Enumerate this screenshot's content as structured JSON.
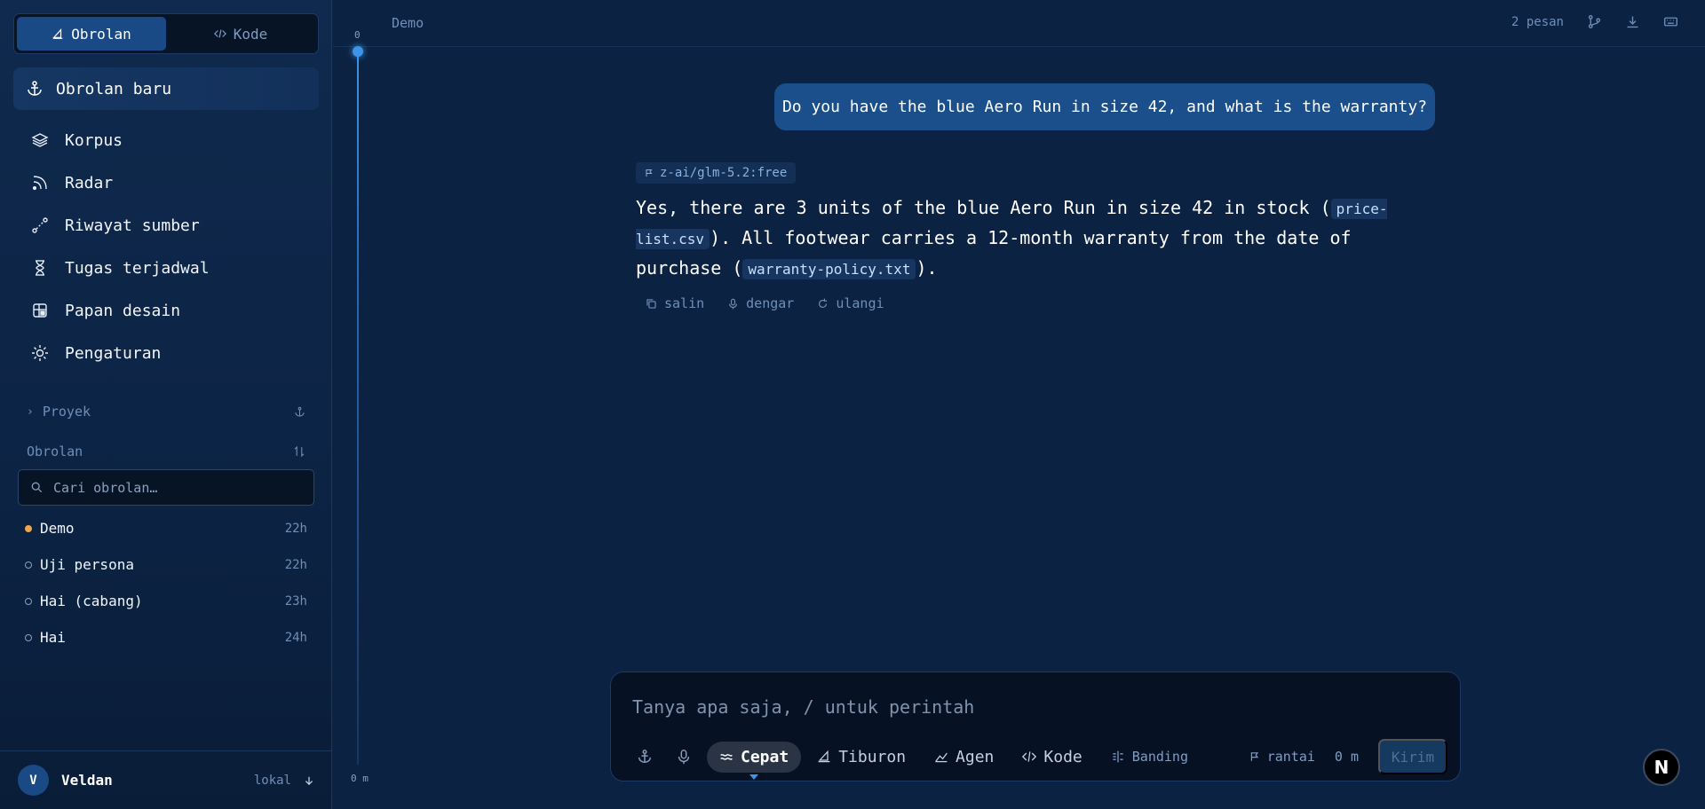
{
  "sidebar": {
    "mode_tabs": [
      {
        "label": "Obrolan",
        "icon": "sail-icon",
        "active": true
      },
      {
        "label": "Kode",
        "icon": "code-icon",
        "active": false
      }
    ],
    "new_chat_label": "Obrolan baru",
    "nav": [
      {
        "label": "Korpus",
        "icon": "layers-icon"
      },
      {
        "label": "Radar",
        "icon": "rss-icon"
      },
      {
        "label": "Riwayat sumber",
        "icon": "route-icon"
      },
      {
        "label": "Tugas terjadwal",
        "icon": "hourglass-icon"
      },
      {
        "label": "Papan desain",
        "icon": "layout-icon"
      },
      {
        "label": "Pengaturan",
        "icon": "sun-gear-icon"
      }
    ],
    "projects_label": "Proyek",
    "chats_section_label": "Obrolan",
    "search_placeholder": "Cari obrolan…",
    "chats": [
      {
        "title": "Demo",
        "time": "22h",
        "active": true
      },
      {
        "title": "Uji persona",
        "time": "22h",
        "active": false
      },
      {
        "title": "Hai (cabang)",
        "time": "23h",
        "active": false
      },
      {
        "title": "Hai",
        "time": "24h",
        "active": false
      }
    ],
    "user": {
      "initial": "V",
      "name": "Veldan",
      "location": "lokal"
    }
  },
  "topbar": {
    "title": "Demo",
    "message_count": "2 pesan"
  },
  "timeline": {
    "top_label": "0",
    "bottom_label": "0 m"
  },
  "conversation": {
    "user_message": "Do you have the blue Aero Run in size 42, and what is the warranty?",
    "model": "z-ai/glm-5.2:free",
    "assistant": {
      "part1": "Yes, there are 3 units of the blue Aero Run in size 42 in stock (",
      "source1": "price-list.csv",
      "part2": "). All footwear carries a 12-month warranty from the date of purchase (",
      "source2": "warranty-policy.txt",
      "part3": ")."
    },
    "actions": {
      "copy": "salin",
      "listen": "dengar",
      "retry": "ulangi"
    }
  },
  "composer": {
    "placeholder": "Tanya apa saja, / untuk perintah",
    "modes": [
      {
        "label": "Cepat",
        "icon": "waves-icon",
        "active": true
      },
      {
        "label": "Tiburon",
        "icon": "sail-icon",
        "active": false
      },
      {
        "label": "Agen",
        "icon": "agent-icon",
        "active": false
      },
      {
        "label": "Kode",
        "icon": "code-icon",
        "active": false
      }
    ],
    "compare_label": "Banding",
    "chain_label": "rantai",
    "elapsed": "0 m",
    "send_label": "Kirim"
  },
  "badge_letter": "N"
}
